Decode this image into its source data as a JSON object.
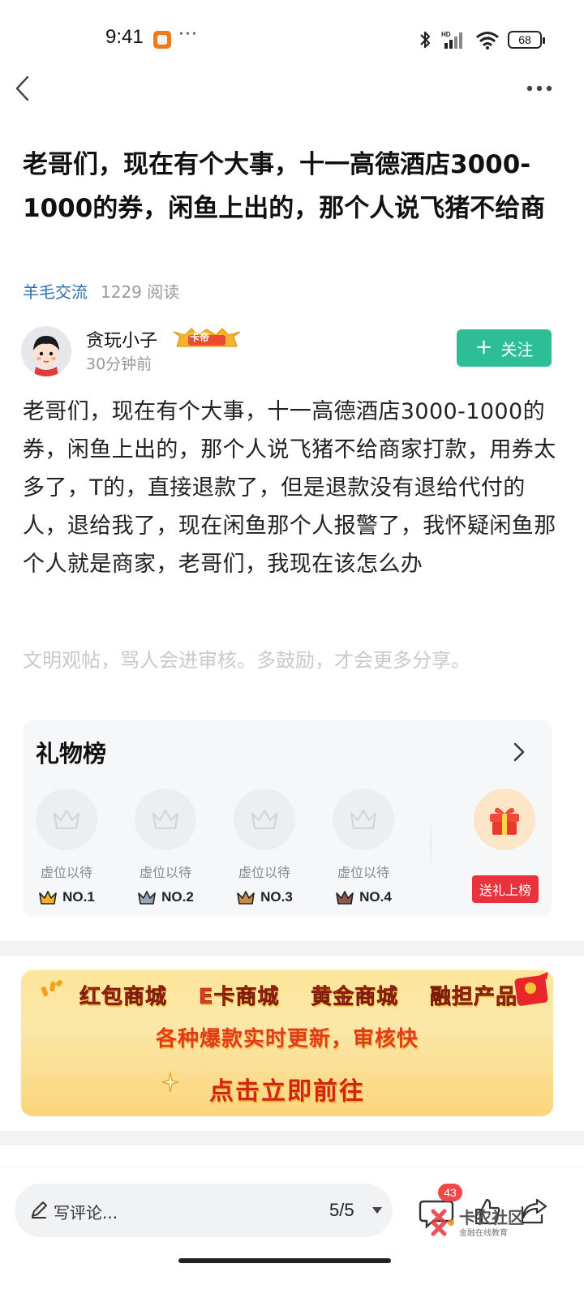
{
  "status_bar": {
    "time": "9:41",
    "more": "···",
    "battery": "68"
  },
  "post": {
    "title": "老哥们，现在有个大事，十一高德酒店3000-1000的券，闲鱼上出的，那个人说飞猪不给商",
    "board": "羊毛交流",
    "reads": "1229 阅读",
    "author": {
      "name": "贪玩小子",
      "badge": "卡帝",
      "time": "30分钟前"
    },
    "follow_label": "关注",
    "body": "老哥们，现在有个大事，十一高德酒店3000-1000的券，闲鱼上出的，那个人说飞猪不给商家打款，用券太多了，T的，直接退款了，但是退款没有退给代付的人，退给我了，现在闲鱼那个人报警了，我怀疑闲鱼那个人就是商家，老哥们，我现在该怎么办",
    "notice": "文明观帖，骂人会进审核。多鼓励，才会更多分享。"
  },
  "gift_board": {
    "title": "礼物榜",
    "slots": [
      {
        "label": "虚位以待",
        "rank": "NO.1",
        "crown_color": "#f2b21c"
      },
      {
        "label": "虚位以待",
        "rank": "NO.2",
        "crown_color": "#9aa6b8"
      },
      {
        "label": "虚位以待",
        "rank": "NO.3",
        "crown_color": "#c98a4b"
      },
      {
        "label": "虚位以待",
        "rank": "NO.4",
        "crown_color": "#8a5a4a"
      }
    ],
    "send_label": "送礼上榜"
  },
  "banner": {
    "items": [
      "红包商城",
      "E卡商城",
      "黄金商城",
      "融担产品"
    ],
    "line2": "各种爆款实时更新，审核快",
    "cta": "点击立即前往"
  },
  "bottom_bar": {
    "comment_placeholder": "写评论...",
    "page": "5/5",
    "comment_count": "43",
    "watermark": "卡农社区",
    "watermark_sub": "金融在线教育"
  },
  "colors": {
    "accent_green": "#2dbe95",
    "link_blue": "#2a6fb0",
    "gift_red": "#e8333c"
  }
}
